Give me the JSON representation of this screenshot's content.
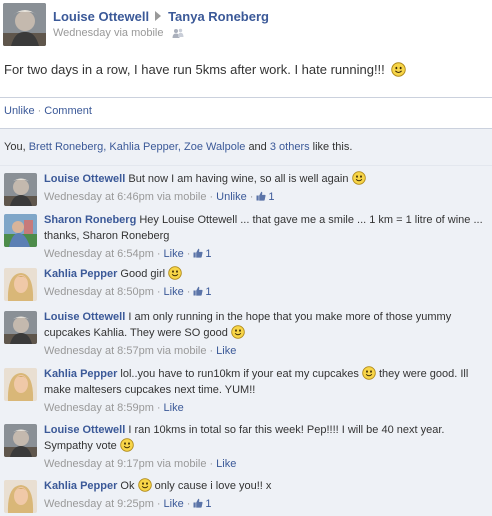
{
  "post": {
    "author": "Louise Ottewell",
    "target": "Tanya Roneberg",
    "meta": "Wednesday via mobile",
    "text": "For two days in a row, I have run 5kms after work. I hate running!!!",
    "actions": {
      "unlike": "Unlike",
      "comment": "Comment"
    }
  },
  "likes": {
    "prefix": "You,",
    "names": [
      "Brett Roneberg,",
      "Kahlia Pepper,",
      "Zoe Walpole"
    ],
    "and": "and",
    "others": "3 others",
    "suffix": "like this."
  },
  "comments": [
    {
      "author": "Louise Ottewell",
      "text": "But now I am having wine, so all is well again",
      "smiley": true,
      "time": "Wednesday at 6:46pm",
      "via": "via mobile",
      "action": "Unlike",
      "likes": "1"
    },
    {
      "author": "Sharon Roneberg",
      "text": "Hey Louise Ottewell ... that gave me a smile ... 1 km = 1 litre of wine ... thanks, Sharon Roneberg",
      "smiley": false,
      "time": "Wednesday at 6:54pm",
      "via": "",
      "action": "Like",
      "likes": "1"
    },
    {
      "author": "Kahlia Pepper",
      "text": "Good girl",
      "smiley": true,
      "time": "Wednesday at 8:50pm",
      "via": "",
      "action": "Like",
      "likes": "1"
    },
    {
      "author": "Louise Ottewell",
      "text": "I am only running in the hope that you make more of those yummy cupcakes Kahlia. They were SO good",
      "smiley": true,
      "time": "Wednesday at 8:57pm",
      "via": "via mobile",
      "action": "Like",
      "likes": ""
    },
    {
      "author": "Kahlia Pepper",
      "text": "lol..you have to run10km if your eat my cupcakes",
      "text2": "they were good. Ill make maltesers cupcakes next time. YUM!!",
      "smiley": true,
      "time": "Wednesday at 8:59pm",
      "via": "",
      "action": "Like",
      "likes": ""
    },
    {
      "author": "Louise Ottewell",
      "text": "I ran 10kms in total so far this week! Pep!!!! I will be 40 next year. Sympathy vote",
      "smiley": true,
      "time": "Wednesday at 9:17pm",
      "via": "via mobile",
      "action": "Like",
      "likes": ""
    },
    {
      "author": "Kahlia Pepper",
      "text": "Ok",
      "text2": "only cause i love you!! x",
      "smiley": true,
      "time": "Wednesday at 9:25pm",
      "via": "",
      "action": "Like",
      "likes": "1"
    }
  ],
  "icons": {
    "smiley": "smiley-icon",
    "thumb": "thumbs-up-icon",
    "people": "people-icon",
    "arrow": "arrow-right-icon"
  },
  "colors": {
    "link": "#3b5998",
    "meta": "#999999",
    "comment_bg": "#eef1f6",
    "smiley": "#f7d548"
  }
}
